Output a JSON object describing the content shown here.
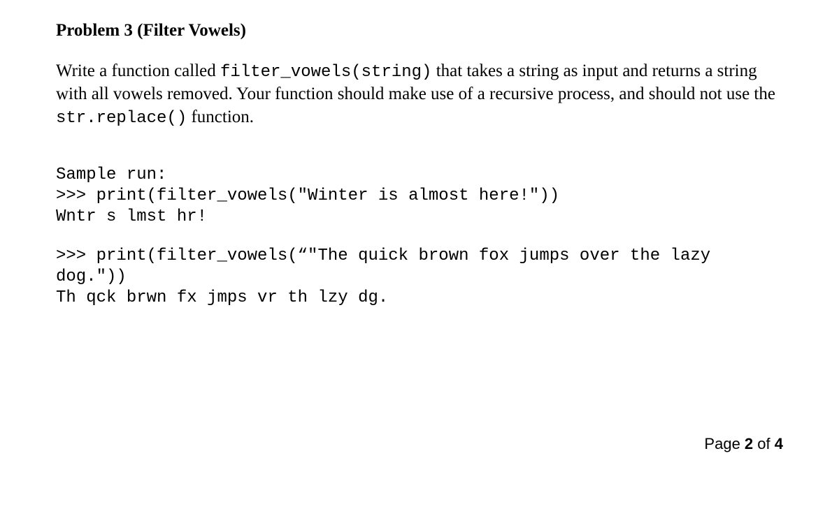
{
  "problem": {
    "title": "Problem 3 (Filter Vowels)",
    "desc_part1": "Write a function called ",
    "code1": "filter_vowels(string)",
    "desc_part2": " that takes a string as input and returns a string with all vowels removed. Your function should make use of a recursive process, and should not use the ",
    "code2": "str.replace()",
    "desc_part3": " function."
  },
  "sample": {
    "header": "Sample run:",
    "line1": ">>> print(filter_vowels(\"Winter is almost here!\"))",
    "line2": "Wntr s lmst hr!",
    "line3": ">>> print(filter_vowels(“\"The quick brown fox jumps over the lazy dog.\"))",
    "line4": "Th qck brwn fx jmps vr th lzy dg."
  },
  "pagination": {
    "prefix": "Page ",
    "current": "2",
    "middle": " of ",
    "total": "4"
  }
}
